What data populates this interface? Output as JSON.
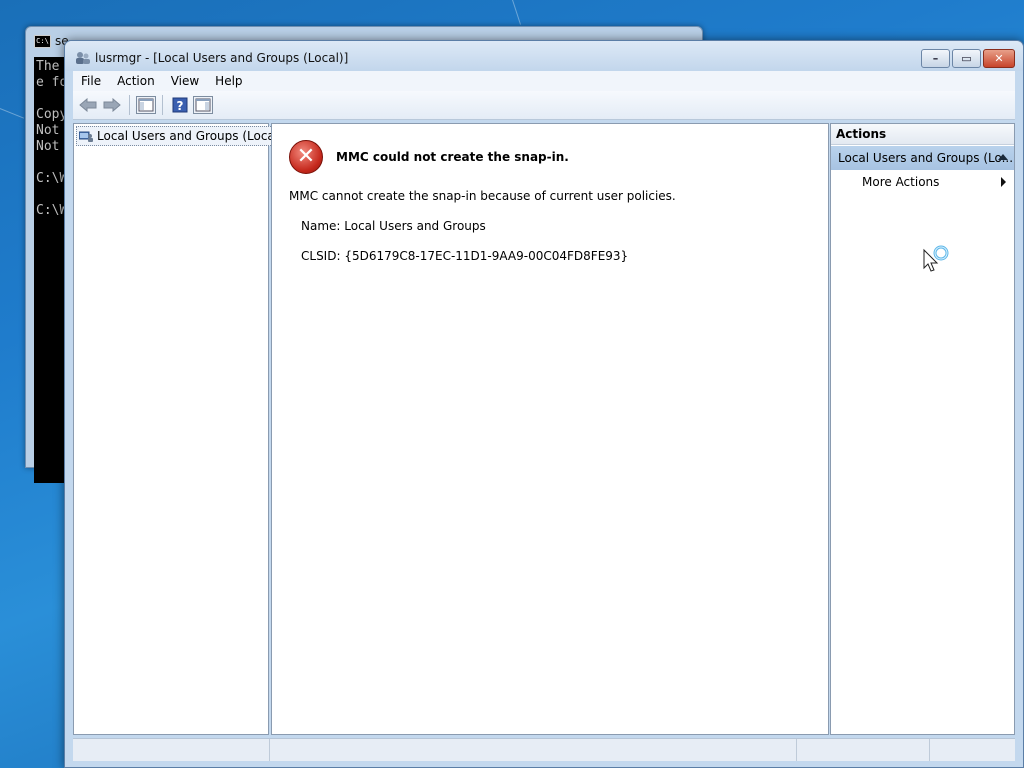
{
  "cmd_window": {
    "title": "se",
    "lines": [
      "The ",
      "e fo",
      "",
      "Copy",
      "Not ",
      "Not ",
      "",
      "C:\\W",
      "",
      "C:\\W"
    ]
  },
  "window": {
    "title": "lusrmgr - [Local Users and Groups (Local)]",
    "minimize_glyph": "–",
    "restore_glyph": "▭",
    "close_glyph": "✕"
  },
  "menu": {
    "items": [
      "File",
      "Action",
      "View",
      "Help"
    ]
  },
  "toolbar": {
    "buttons": [
      "back-arrow-icon",
      "forward-arrow-icon",
      "show-hide-console-tree-icon",
      "help-icon",
      "show-hide-action-pane-icon"
    ]
  },
  "tree": {
    "root_label": "Local Users and Groups (Local)"
  },
  "error": {
    "title": "MMC could not create the snap-in.",
    "message": "MMC cannot create the snap-in because of current user policies.",
    "name_line": "Name: Local Users and Groups",
    "clsid_line": "CLSID: {5D6179C8-17EC-11D1-9AA9-00C04FD8FE93}"
  },
  "actions": {
    "header": "Actions",
    "section_label": "Local Users and Groups (Lo...",
    "more_actions": "More Actions"
  },
  "colors": {
    "error_red": "#c5281c",
    "section_blue": "#b9d2ec"
  }
}
